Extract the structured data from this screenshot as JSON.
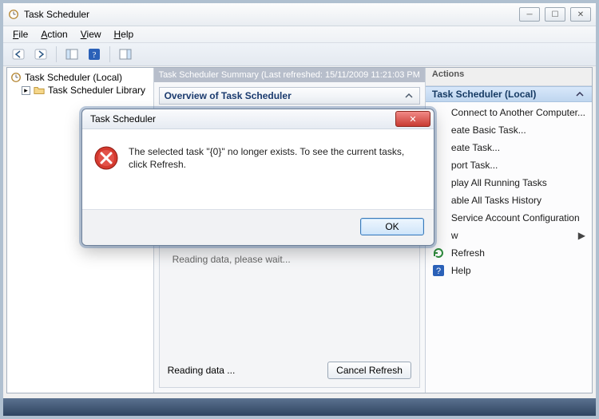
{
  "window": {
    "title": "Task Scheduler"
  },
  "menu": {
    "file": "File",
    "action": "Action",
    "view": "View",
    "help": "Help"
  },
  "tree": {
    "root": "Task Scheduler (Local)",
    "library": "Task Scheduler Library"
  },
  "central": {
    "summary_header": "Task Scheduler Summary (Last refreshed: 15/11/2009 11:21:03 PM",
    "overview": "Overview of Task Scheduler",
    "reading_main": "Reading data, please wait...",
    "reading_footer": "Reading data ...",
    "cancel_refresh": "Cancel Refresh"
  },
  "actions": {
    "header": "Actions",
    "group": "Task Scheduler (Local)",
    "items": {
      "connect": "Connect to Another Computer...",
      "create_basic": "eate Basic Task...",
      "create_task": "eate Task...",
      "import_task": "port Task...",
      "display_running": "play All Running Tasks",
      "enable_history": "able All Tasks History",
      "service_account": "Service Account Configuration",
      "view": "w",
      "refresh": "Refresh",
      "help": "Help"
    }
  },
  "dialog": {
    "title": "Task Scheduler",
    "message": "The selected task \"{0}\" no longer exists. To see the current tasks, click Refresh.",
    "ok": "OK"
  }
}
